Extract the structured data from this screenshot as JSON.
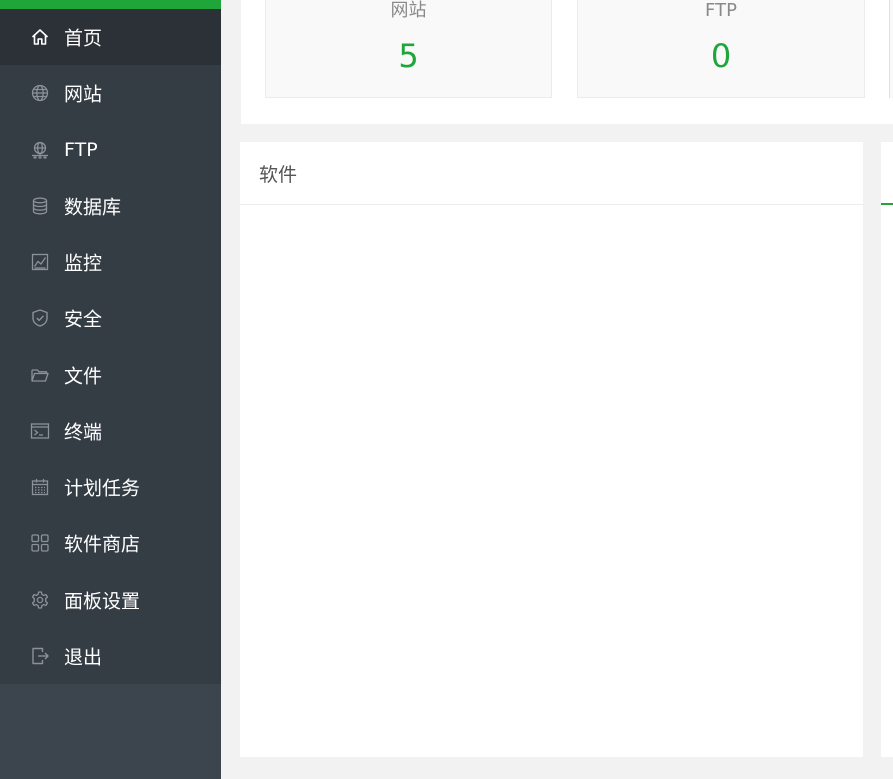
{
  "sidebar": {
    "accent_color": "#20a53a",
    "items": [
      {
        "label": "首页",
        "icon": "home-icon",
        "active": true
      },
      {
        "label": "网站",
        "icon": "globe-icon",
        "active": false
      },
      {
        "label": "FTP",
        "icon": "ftp-icon",
        "active": false
      },
      {
        "label": "数据库",
        "icon": "database-icon",
        "active": false
      },
      {
        "label": "监控",
        "icon": "monitor-icon",
        "active": false
      },
      {
        "label": "安全",
        "icon": "shield-icon",
        "active": false
      },
      {
        "label": "文件",
        "icon": "folder-icon",
        "active": false
      },
      {
        "label": "终端",
        "icon": "terminal-icon",
        "active": false
      },
      {
        "label": "计划任务",
        "icon": "calendar-icon",
        "active": false
      },
      {
        "label": "软件商店",
        "icon": "apps-grid-icon",
        "active": false
      },
      {
        "label": "面板设置",
        "icon": "gear-icon",
        "active": false
      },
      {
        "label": "退出",
        "icon": "logout-icon",
        "active": false
      }
    ]
  },
  "stats": {
    "value_color": "#20a53a",
    "cards": [
      {
        "title": "网站",
        "value": "5"
      },
      {
        "title": "FTP",
        "value": "0"
      }
    ]
  },
  "software_panel": {
    "title": "软件"
  }
}
